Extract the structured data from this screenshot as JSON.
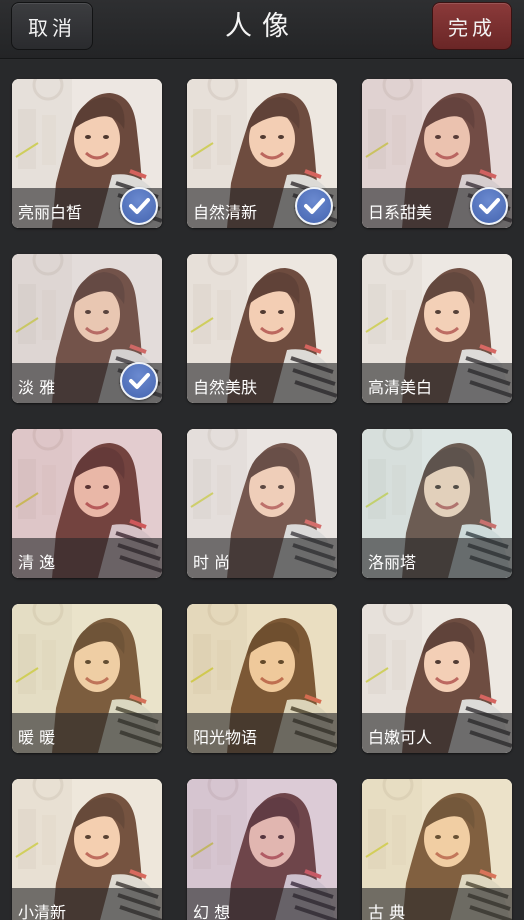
{
  "header": {
    "cancel_label": "取消",
    "title": "人像",
    "done_label": "完成"
  },
  "colors": {
    "done_button": "#7a3030",
    "check_badge": "#4565b0",
    "background": "#2a2b2d"
  },
  "filters": [
    {
      "label": "亮丽白皙",
      "selected": true,
      "tint": "rgba(255,255,255,0.10)"
    },
    {
      "label": "自然清新",
      "selected": true,
      "tint": "rgba(255,250,235,0.12)"
    },
    {
      "label": "日系甜美",
      "selected": true,
      "tint": "rgba(210,170,190,0.20)"
    },
    {
      "label": "淡 雅",
      "selected": true,
      "tint": "rgba(200,190,200,0.22)"
    },
    {
      "label": "自然美肤",
      "selected": false,
      "tint": "rgba(255,245,235,0.12)"
    },
    {
      "label": "高清美白",
      "selected": false,
      "tint": "rgba(255,255,255,0.14)"
    },
    {
      "label": "清 逸",
      "selected": false,
      "tint": "rgba(200,120,150,0.22)"
    },
    {
      "label": "时 尚",
      "selected": false,
      "tint": "rgba(230,230,240,0.20)"
    },
    {
      "label": "洛丽塔",
      "selected": false,
      "tint": "rgba(170,230,240,0.22)"
    },
    {
      "label": "暖 暖",
      "selected": false,
      "tint": "rgba(230,220,140,0.24)"
    },
    {
      "label": "阳光物语",
      "selected": false,
      "tint": "rgba(230,200,100,0.24)"
    },
    {
      "label": "白嫩可人",
      "selected": false,
      "tint": "rgba(255,255,255,0.12)"
    },
    {
      "label": "小清新",
      "selected": false,
      "tint": "rgba(255,240,200,0.16)"
    },
    {
      "label": "幻 想",
      "selected": false,
      "tint": "rgba(170,120,190,0.24)"
    },
    {
      "label": "古 典",
      "selected": false,
      "tint": "rgba(240,220,140,0.26)"
    }
  ]
}
